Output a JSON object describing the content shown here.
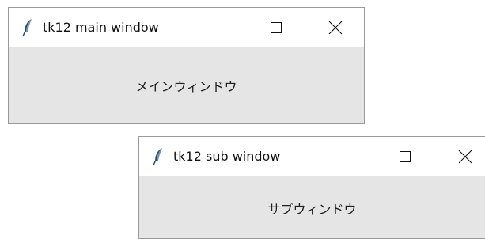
{
  "main_window": {
    "title": "tk12 main window",
    "icon": "feather-icon",
    "controls": [
      "minimize-icon",
      "maximize-icon",
      "close-icon"
    ],
    "body_label": "メインウィンドウ"
  },
  "sub_window": {
    "title": "tk12 sub window",
    "icon": "feather-icon",
    "controls": [
      "minimize-icon",
      "maximize-icon",
      "close-icon"
    ],
    "body_label": "サブウィンドウ"
  },
  "colors": {
    "titlebar": "#ffffff",
    "client_area": "#e5e5e5",
    "border": "#9a9a9a",
    "text": "#202020"
  }
}
